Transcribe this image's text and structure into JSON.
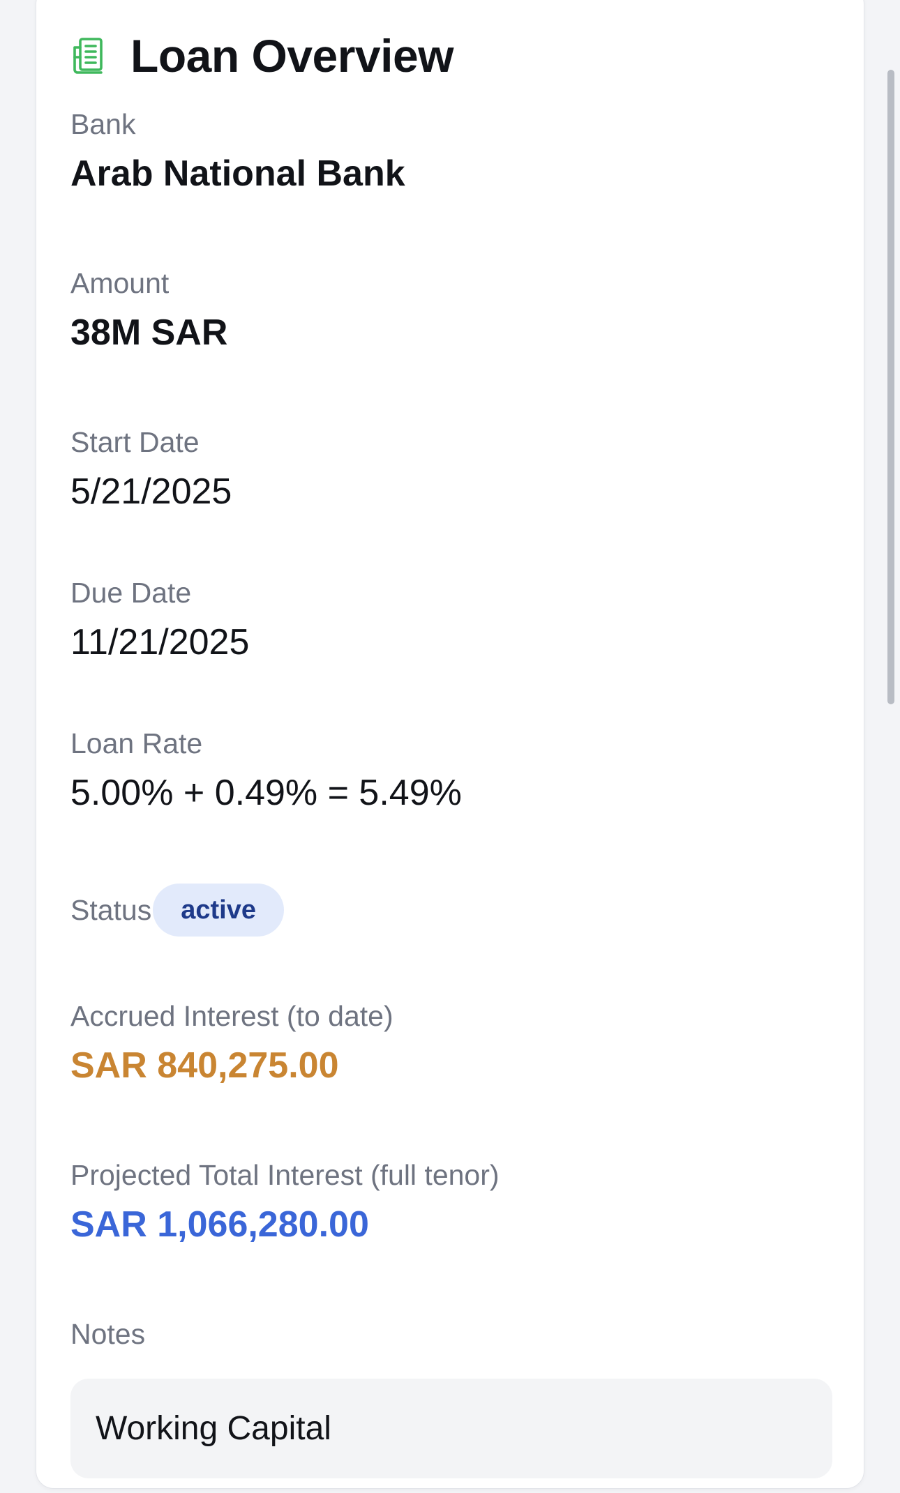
{
  "header": {
    "title": "Loan Overview",
    "icon": "ledger-document-icon",
    "icon_color": "#3fb85c"
  },
  "fields": {
    "bank": {
      "label": "Bank",
      "value": "Arab National Bank"
    },
    "amount": {
      "label": "Amount",
      "value": "38M SAR"
    },
    "start_date": {
      "label": "Start Date",
      "value": "5/21/2025"
    },
    "due_date": {
      "label": "Due Date",
      "value": "11/21/2025"
    },
    "loan_rate": {
      "label": "Loan Rate",
      "value": "5.00% + 0.49% = 5.49%"
    },
    "status": {
      "label": "Status",
      "value": "active"
    },
    "accrued_interest": {
      "label": "Accrued Interest (to date)",
      "value": "SAR 840,275.00",
      "color": "#c98532"
    },
    "projected_interest": {
      "label": "Projected Total Interest (full tenor)",
      "value": "SAR 1,066,280.00",
      "color": "#3a66d8"
    },
    "notes": {
      "label": "Notes",
      "value": "Working Capital"
    }
  }
}
